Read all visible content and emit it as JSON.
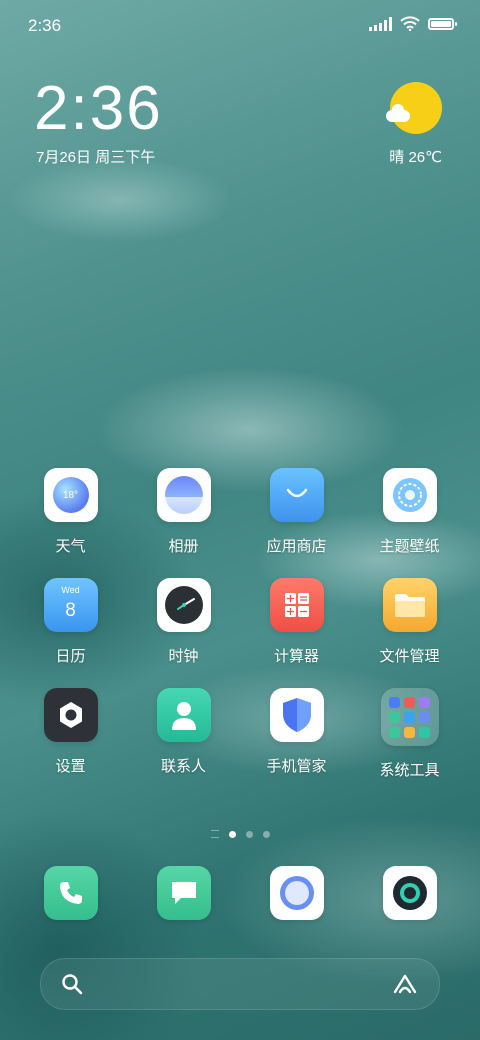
{
  "status_bar": {
    "time": "2:36",
    "battery_level": 1.0
  },
  "clock_widget": {
    "time": "2:36",
    "date": "7月26日 周三下午"
  },
  "weather_widget": {
    "text": "晴 26℃"
  },
  "apps": [
    {
      "label": "天气",
      "icon": "weather-icon",
      "badge": "18°"
    },
    {
      "label": "相册",
      "icon": "gallery-icon"
    },
    {
      "label": "应用商店",
      "icon": "app-store-icon"
    },
    {
      "label": "主题壁纸",
      "icon": "themes-icon"
    },
    {
      "label": "日历",
      "icon": "calendar-icon",
      "weekday": "Wed",
      "day": "8"
    },
    {
      "label": "时钟",
      "icon": "clock-icon"
    },
    {
      "label": "计算器",
      "icon": "calculator-icon"
    },
    {
      "label": "文件管理",
      "icon": "folder-icon"
    },
    {
      "label": "设置",
      "icon": "settings-icon"
    },
    {
      "label": "联系人",
      "icon": "contacts-icon"
    },
    {
      "label": "手机管家",
      "icon": "security-shield-icon"
    },
    {
      "label": "系统工具",
      "icon": "system-tools-folder-icon"
    }
  ],
  "page_indicator": {
    "pages": 3,
    "current_page": 1
  },
  "dock": [
    {
      "icon": "phone-icon"
    },
    {
      "icon": "messages-icon"
    },
    {
      "icon": "browser-icon"
    },
    {
      "icon": "camera-icon"
    }
  ],
  "search_bar": {
    "left_icon": "search-icon",
    "right_icon": "assistant-icon"
  },
  "colors": {
    "sun": "#f7cf16",
    "app_store": "#4aa3f2",
    "calculator": "#f25a4f",
    "folder": "#f6b73c",
    "contacts": "#2ec6a4",
    "phone": "#3cc79a",
    "messages": "#3cc79a"
  }
}
